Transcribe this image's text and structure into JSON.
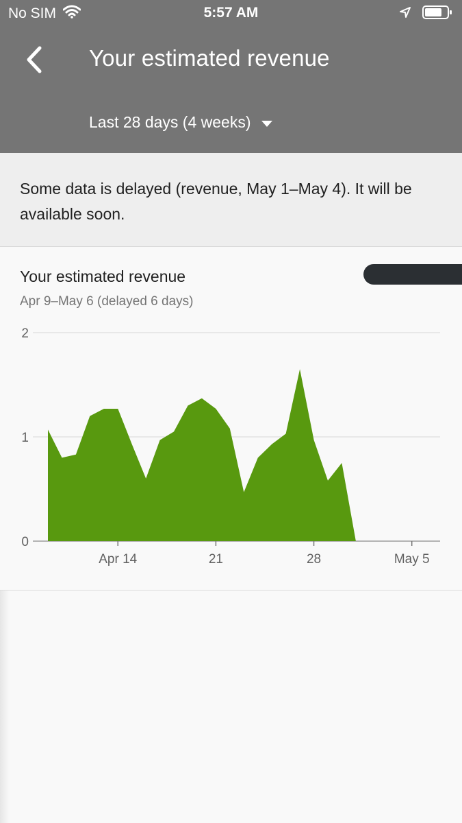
{
  "status_bar": {
    "carrier": "No SIM",
    "time": "5:57 AM"
  },
  "header": {
    "title": "Your estimated revenue",
    "range_label": "Last 28 days (4 weeks)"
  },
  "notice": {
    "text": "Some data is delayed (revenue, May 1–May 4). It will be available soon."
  },
  "card": {
    "title": "Your estimated revenue",
    "subtitle": "Apr 9–May 6 (delayed 6 days)"
  },
  "chart_data": {
    "type": "area",
    "color": "#58990f",
    "x_ticks": [
      "Apr 14",
      "21",
      "28",
      "May 5"
    ],
    "y_ticks": [
      "0",
      "1",
      "2"
    ],
    "ylim": [
      0,
      2
    ],
    "grid": true,
    "series": [
      {
        "x": [
          "Apr 9",
          "Apr 10",
          "Apr 11",
          "Apr 12",
          "Apr 13",
          "Apr 14",
          "Apr 15",
          "Apr 16",
          "Apr 17",
          "Apr 18",
          "Apr 19",
          "Apr 20",
          "Apr 21",
          "Apr 22",
          "Apr 23",
          "Apr 24",
          "Apr 25",
          "Apr 26",
          "Apr 27",
          "Apr 28",
          "Apr 29",
          "Apr 30",
          "May 1"
        ],
        "values": [
          1.07,
          0.8,
          0.83,
          1.2,
          1.27,
          1.27,
          0.93,
          0.6,
          0.97,
          1.05,
          1.3,
          1.37,
          1.27,
          1.08,
          0.47,
          0.8,
          0.93,
          1.03,
          1.65,
          0.97,
          0.58,
          0.75,
          0
        ]
      }
    ]
  }
}
